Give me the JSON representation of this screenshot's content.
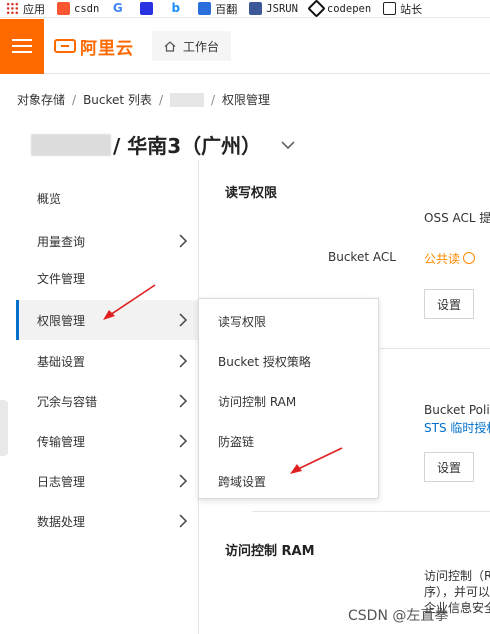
{
  "bookmarks": [
    {
      "label": "应用",
      "icon": "apps-grid-icon"
    },
    {
      "label": "csdn",
      "icon": "csdn-icon"
    },
    {
      "label": "",
      "icon": "google-icon"
    },
    {
      "label": "",
      "icon": "baidu-paw-icon"
    },
    {
      "label": "",
      "icon": "bing-icon"
    },
    {
      "label": "百翻",
      "icon": "baidu-translate-icon"
    },
    {
      "label": "JSRUN",
      "icon": "jsrun-icon"
    },
    {
      "label": "codepen",
      "icon": "codepen-icon"
    },
    {
      "label": "站长",
      "icon": "site-icon"
    }
  ],
  "topbar": {
    "logo_text": "阿里云",
    "workbench_label": "工作台",
    "brand_color": "#ff6a00"
  },
  "breadcrumb": {
    "item1": "对象存储",
    "item2": "Bucket 列表",
    "item4": "权限管理",
    "separator": "/"
  },
  "header": {
    "region_title": "/ 华南3（广州）"
  },
  "sidebar": {
    "items": [
      {
        "label": "概览",
        "has_arrow": false
      },
      {
        "label": "用量查询",
        "has_arrow": true
      },
      {
        "label": "文件管理",
        "has_arrow": false
      },
      {
        "label": "权限管理",
        "has_arrow": true,
        "active": true
      },
      {
        "label": "基础设置",
        "has_arrow": true
      },
      {
        "label": "冗余与容错",
        "has_arrow": true
      },
      {
        "label": "传输管理",
        "has_arrow": true
      },
      {
        "label": "日志管理",
        "has_arrow": true
      },
      {
        "label": "数据处理",
        "has_arrow": true
      }
    ],
    "active_color": "#0070cc"
  },
  "main": {
    "rw_section_title": "读写权限",
    "oss_acl_text": "OSS ACL 提",
    "bucket_acl_label": "Bucket ACL",
    "bucket_acl_value": "公共读",
    "setup_button": "设置",
    "bucket_policy_text": "Bucket Polic",
    "sts_link": "STS 临时授权",
    "setup_button_2": "设置",
    "ram_section_title": "访问控制 RAM",
    "ram_desc_line1": "访问控制（R",
    "ram_desc_line2": "序），并可以",
    "ram_desc_line3": "企业信息安全"
  },
  "dropdown": {
    "items": [
      "读写权限",
      "Bucket 授权策略",
      "访问控制 RAM",
      "防盗链",
      "跨域设置"
    ]
  },
  "annotation_color": "#e02020",
  "watermark": "CSDN @左直拳"
}
